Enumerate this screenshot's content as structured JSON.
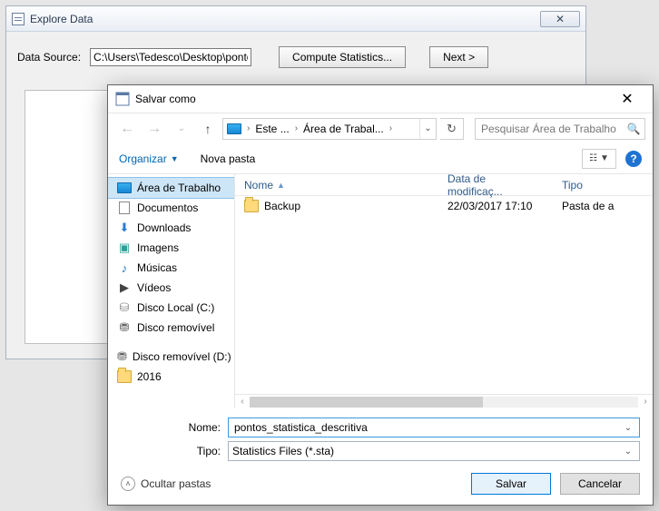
{
  "bgWindow": {
    "title": "Explore Data",
    "dataSourceLabel": "Data Source:",
    "dataSourcePath": "C:\\Users\\Tedesco\\Desktop\\pontosce.txt",
    "computeBtn": "Compute Statistics...",
    "nextBtn": "Next >",
    "closeGlyph": "✕"
  },
  "dialog": {
    "title": "Salvar como",
    "nav": {
      "seg1": "Este ...",
      "seg2": "Área de Trabal...",
      "searchPlaceholder": "Pesquisar Área de Trabalho"
    },
    "toolbar": {
      "organize": "Organizar",
      "newFolder": "Nova pasta"
    },
    "tree": [
      {
        "icon": "monitor",
        "label": "Área de Trabalho",
        "selected": true
      },
      {
        "icon": "doc",
        "label": "Documentos"
      },
      {
        "icon": "down",
        "label": "Downloads"
      },
      {
        "icon": "img",
        "label": "Imagens"
      },
      {
        "icon": "music",
        "label": "Músicas"
      },
      {
        "icon": "video",
        "label": "Vídeos"
      },
      {
        "icon": "drive",
        "label": "Disco Local (C:)"
      },
      {
        "icon": "usb",
        "label": "Disco removível"
      },
      {
        "icon": "blank",
        "label": ""
      },
      {
        "icon": "usb",
        "label": "Disco removível (D:)"
      },
      {
        "icon": "folder",
        "label": "2016"
      }
    ],
    "columns": {
      "name": "Nome",
      "date": "Data de modificaç...",
      "type": "Tipo"
    },
    "rows": [
      {
        "name": "Backup",
        "date": "22/03/2017 17:10",
        "type": "Pasta de a"
      }
    ],
    "fields": {
      "nameLabel": "Nome:",
      "nameValue": "pontos_statistica_descritiva",
      "typeLabel": "Tipo:",
      "typeValue": "Statistics Files (*.sta)"
    },
    "footer": {
      "hide": "Ocultar pastas",
      "save": "Salvar",
      "cancel": "Cancelar"
    }
  }
}
